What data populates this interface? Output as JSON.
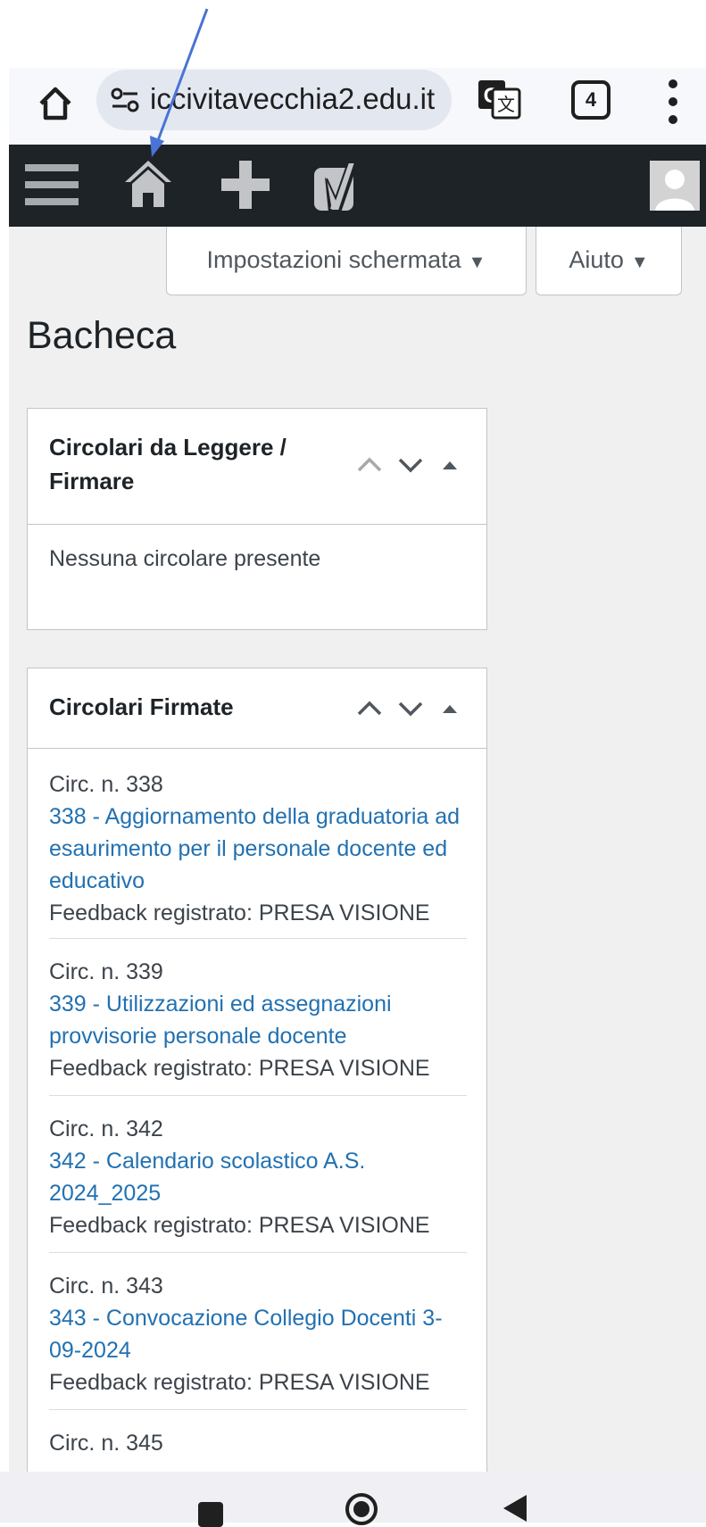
{
  "browser": {
    "url": "iccivitavecchia2.edu.it",
    "tab_count": "4",
    "icons": [
      "home-icon",
      "site-settings-icon",
      "translate-icon",
      "tabs-icon",
      "more-vert-icon"
    ]
  },
  "admin_bar": {
    "icons": [
      "menu-icon",
      "home-icon",
      "plus-icon",
      "yoast-icon",
      "avatar"
    ]
  },
  "screen_meta": {
    "options_label": "Impostazioni schermata",
    "help_label": "Aiuto"
  },
  "page": {
    "title": "Bacheca"
  },
  "widgets": {
    "to_read": {
      "title": "Circolari da Leggere / Firmare",
      "empty_text": "Nessuna circolare presente"
    },
    "signed": {
      "title": "Circolari Firmate",
      "items": [
        {
          "number": "Circ. n. 338",
          "link": "338 - Aggiornamento della graduatoria ad esaurimento per il personale docente ed educativo",
          "feedback": "Feedback registrato: PRESA VISIONE"
        },
        {
          "number": "Circ. n. 339",
          "link": "339 - Utilizzazioni ed assegnazioni provvisorie personale docente",
          "feedback": "Feedback registrato: PRESA VISIONE"
        },
        {
          "number": "Circ. n. 342",
          "link": "342 - Calendario scolastico A.S. 2024_2025",
          "feedback": "Feedback registrato: PRESA VISIONE"
        },
        {
          "number": "Circ. n. 343",
          "link": "343 - Convocazione Collegio Docenti 3-09-2024",
          "feedback": "Feedback registrato: PRESA VISIONE"
        },
        {
          "number": "Circ. n. 345"
        }
      ]
    }
  },
  "colors": {
    "admin_bar_bg": "#1d2327",
    "link": "#2271b1",
    "annotation_arrow": "#4a73d6"
  }
}
